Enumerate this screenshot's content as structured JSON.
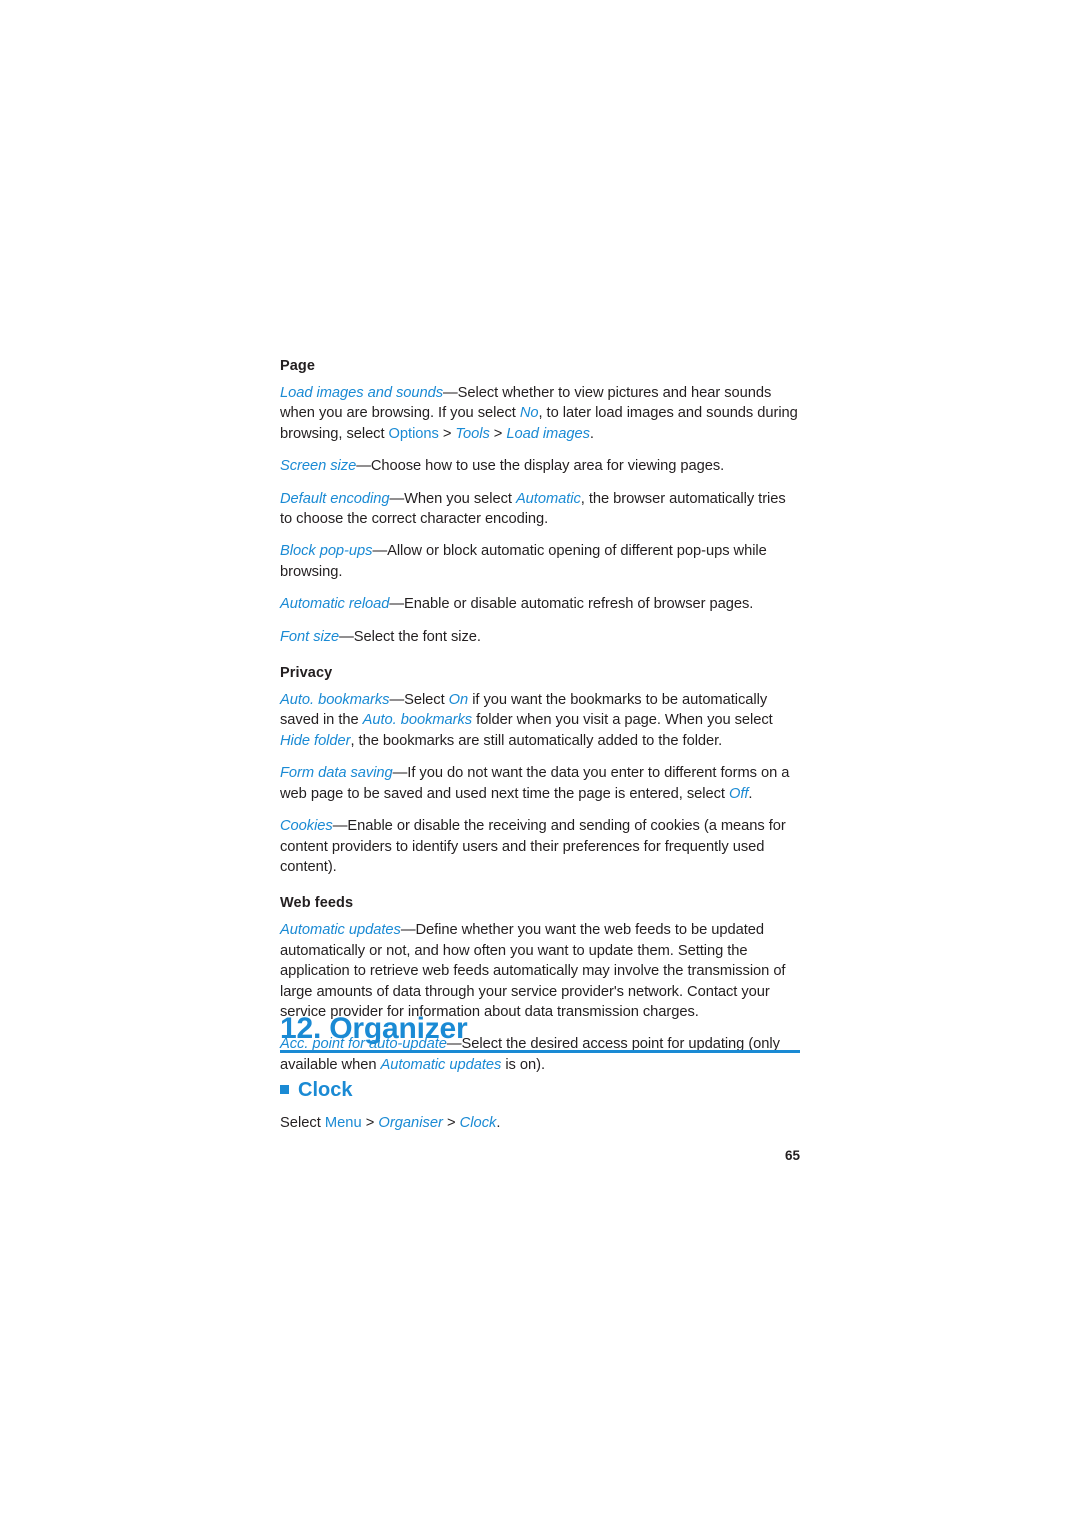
{
  "document": {
    "page_number": "65",
    "accent_color": "#1a8ad4",
    "body_color": "#231f20"
  },
  "sections": {
    "page": {
      "heading": "Page",
      "paragraphs": [
        {
          "runs": [
            {
              "t": "Load images and sounds",
              "s": "it"
            },
            {
              "t": "—Select whether to view pictures and hear sounds when you are browsing. If you select ",
              "s": ""
            },
            {
              "t": "No",
              "s": "it"
            },
            {
              "t": ", to later load images and sounds during browsing, select ",
              "s": ""
            },
            {
              "t": "Options",
              "s": "bl"
            },
            {
              "t": " > ",
              "s": ""
            },
            {
              "t": "Tools",
              "s": "it"
            },
            {
              "t": " > ",
              "s": ""
            },
            {
              "t": "Load images",
              "s": "it"
            },
            {
              "t": ".",
              "s": ""
            }
          ]
        },
        {
          "runs": [
            {
              "t": "Screen size",
              "s": "it"
            },
            {
              "t": "—Choose how to use the display area for viewing pages.",
              "s": ""
            }
          ]
        },
        {
          "runs": [
            {
              "t": "Default encoding",
              "s": "it"
            },
            {
              "t": "—When you select ",
              "s": ""
            },
            {
              "t": "Automatic",
              "s": "it"
            },
            {
              "t": ", the browser automatically tries to choose the correct character encoding.",
              "s": ""
            }
          ]
        },
        {
          "runs": [
            {
              "t": "Block pop-ups",
              "s": "it"
            },
            {
              "t": "—Allow or block automatic opening of different pop-ups while browsing.",
              "s": ""
            }
          ]
        },
        {
          "runs": [
            {
              "t": "Automatic reload",
              "s": "it"
            },
            {
              "t": "—Enable or disable automatic refresh of browser pages.",
              "s": ""
            }
          ]
        },
        {
          "runs": [
            {
              "t": "Font size",
              "s": "it"
            },
            {
              "t": "—Select the font size.",
              "s": ""
            }
          ]
        }
      ]
    },
    "privacy": {
      "heading": "Privacy",
      "paragraphs": [
        {
          "runs": [
            {
              "t": "Auto. bookmarks",
              "s": "it"
            },
            {
              "t": "—Select ",
              "s": ""
            },
            {
              "t": "On",
              "s": "it"
            },
            {
              "t": " if you want the bookmarks to be automatically saved in the ",
              "s": ""
            },
            {
              "t": "Auto. bookmarks",
              "s": "it"
            },
            {
              "t": " folder when you visit a page. When you select ",
              "s": ""
            },
            {
              "t": "Hide folder",
              "s": "it"
            },
            {
              "t": ", the bookmarks are still automatically added to the folder.",
              "s": ""
            }
          ]
        },
        {
          "runs": [
            {
              "t": "Form data saving",
              "s": "it"
            },
            {
              "t": "—If you do not want the data you enter to different forms on a web page to be saved and used next time the page is entered, select ",
              "s": ""
            },
            {
              "t": "Off",
              "s": "it"
            },
            {
              "t": ".",
              "s": ""
            }
          ]
        },
        {
          "runs": [
            {
              "t": "Cookies",
              "s": "it"
            },
            {
              "t": "—Enable or disable the receiving and sending of cookies (a means for content providers to identify users and their preferences for frequently used content).",
              "s": ""
            }
          ]
        }
      ]
    },
    "web_feeds": {
      "heading": "Web feeds",
      "paragraphs": [
        {
          "runs": [
            {
              "t": "Automatic updates",
              "s": "it"
            },
            {
              "t": "—Define whether you want the web feeds to be updated automatically or not, and how often you want to update them. Setting the application to retrieve web feeds automatically may involve the transmission of large amounts of data through your service provider's network. Contact your service provider for information about data transmission charges.",
              "s": ""
            }
          ]
        },
        {
          "runs": [
            {
              "t": "Acc. point for auto-update",
              "s": "it"
            },
            {
              "t": "—Select the desired access point for updating (only available when ",
              "s": ""
            },
            {
              "t": "Automatic updates",
              "s": "it"
            },
            {
              "t": " is on).",
              "s": ""
            }
          ]
        }
      ]
    }
  },
  "chapter": {
    "title": "12. Organizer"
  },
  "clock_section": {
    "title": "Clock",
    "select_line": {
      "runs": [
        {
          "t": "Select ",
          "s": ""
        },
        {
          "t": "Menu",
          "s": "bl"
        },
        {
          "t": " > ",
          "s": ""
        },
        {
          "t": "Organiser",
          "s": "it"
        },
        {
          "t": " > ",
          "s": ""
        },
        {
          "t": "Clock",
          "s": "it"
        },
        {
          "t": ".",
          "s": ""
        }
      ]
    }
  }
}
